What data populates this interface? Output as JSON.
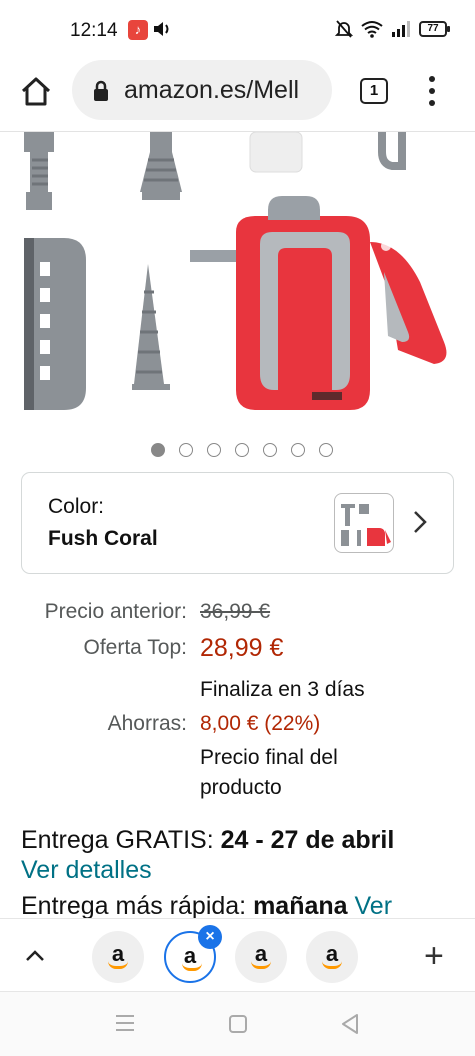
{
  "status_bar": {
    "time": "12:14",
    "battery": "77"
  },
  "browser": {
    "url": "amazon.es/Mell",
    "tab_count": "1"
  },
  "product": {
    "carousel": {
      "total_images": 7,
      "active_index": 0
    },
    "color": {
      "label": "Color:",
      "value": "Fush Coral"
    },
    "prices": {
      "previous_label": "Precio anterior:",
      "previous_value": "36,99 €",
      "offer_label": "Oferta Top:",
      "offer_value": "28,99 €",
      "offer_note": "Finaliza en 3 días",
      "savings_label": "Ahorras:",
      "savings_value": "8,00 € (22%)",
      "final_note_1": "Precio final del",
      "final_note_2": "producto"
    },
    "delivery": {
      "free_prefix": "Entrega GRATIS: ",
      "free_dates": "24 - 27 de abril",
      "details_link": "Ver detalles",
      "fast_prefix": "Entrega más rápida: ",
      "fast_day": "mañana",
      "fast_link": "Ver"
    }
  },
  "tab_strip": {
    "tabs": [
      {
        "label": "a",
        "active": false
      },
      {
        "label": "a",
        "active": true
      },
      {
        "label": "a",
        "active": false
      },
      {
        "label": "a",
        "active": false
      }
    ]
  },
  "colors": {
    "link": "#007185",
    "price_red": "#b12704",
    "accent_blue": "#1a73e8",
    "product_red": "#e8353e"
  }
}
